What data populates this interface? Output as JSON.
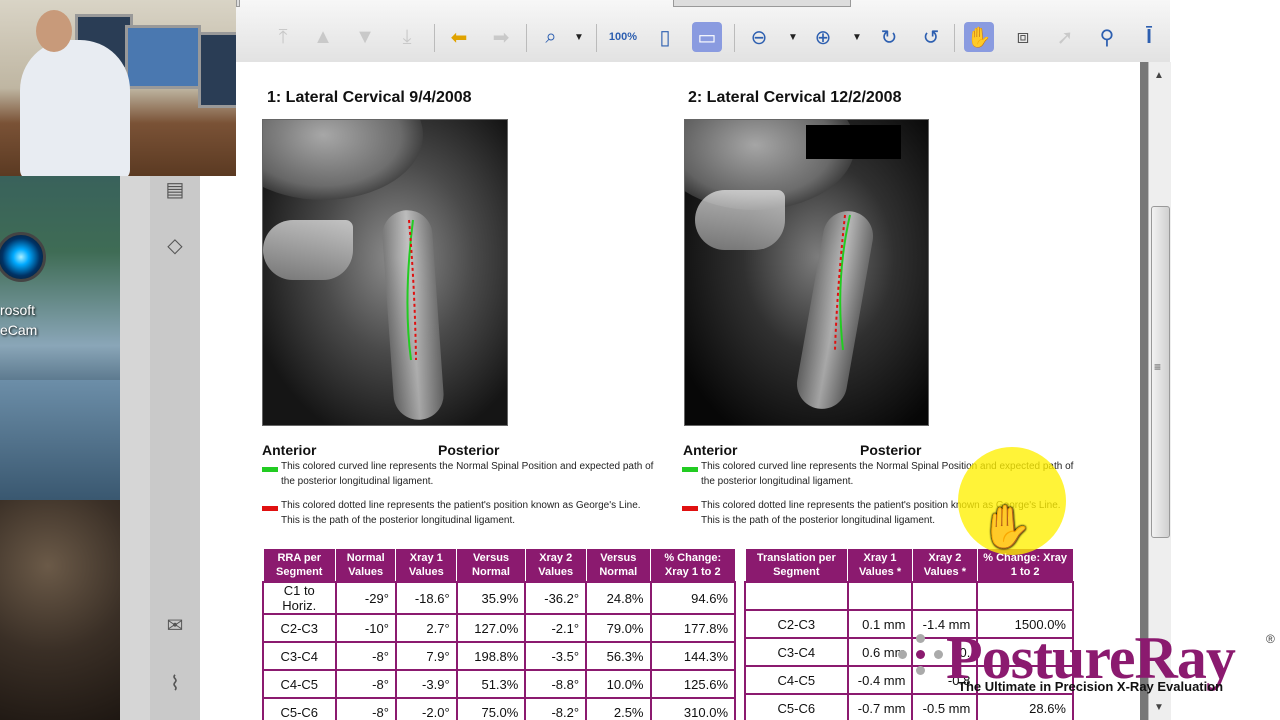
{
  "desktop": {
    "icon_name": "webcam-icon",
    "label_line1": "rosoft",
    "label_line2": "eCam"
  },
  "sidebar": {
    "icons": [
      "page-icon",
      "layers-icon",
      "comment-icon",
      "paperclip-icon"
    ]
  },
  "toolbar": {
    "buttons": [
      {
        "name": "first-page-icon",
        "glyph": "⤒",
        "state": "disabled"
      },
      {
        "name": "prev-page-icon",
        "glyph": "▲",
        "state": "disabled"
      },
      {
        "name": "next-page-icon",
        "glyph": "▼",
        "state": "disabled"
      },
      {
        "name": "last-page-icon",
        "glyph": "⤓",
        "state": "disabled"
      },
      {
        "name": "back-arrow-icon",
        "glyph": "⬅",
        "state": "yellow"
      },
      {
        "name": "forward-arrow-icon",
        "glyph": "➡",
        "state": "disabled"
      },
      {
        "name": "zoom-icon",
        "glyph": "🔍︎",
        "state": "normal"
      },
      {
        "name": "actual-size-icon",
        "glyph": "100%",
        "state": "normal"
      },
      {
        "name": "fit-page-icon",
        "glyph": "▯",
        "state": "normal"
      },
      {
        "name": "fit-width-icon",
        "glyph": "▭",
        "state": "normal"
      },
      {
        "name": "zoom-out-icon",
        "glyph": "⊖",
        "state": "normal"
      },
      {
        "name": "zoom-in-icon",
        "glyph": "⊕",
        "state": "normal"
      },
      {
        "name": "rotate-cw-icon",
        "glyph": "↻",
        "state": "normal"
      },
      {
        "name": "rotate-ccw-icon",
        "glyph": "↺",
        "state": "normal"
      },
      {
        "name": "hand-tool-icon",
        "glyph": "✋",
        "state": "active"
      },
      {
        "name": "snapshot-icon",
        "glyph": "⧈",
        "state": "normal"
      },
      {
        "name": "select-arrow-icon",
        "glyph": "➚",
        "state": "disabled"
      },
      {
        "name": "binoculars-icon",
        "glyph": "⚲",
        "state": "normal"
      },
      {
        "name": "text-select-icon",
        "glyph": "𝐈T",
        "state": "normal"
      }
    ]
  },
  "document": {
    "xray1_title": "1: Lateral Cervical  9/4/2008",
    "xray2_title": "2: Lateral Cervical  12/2/2008",
    "anterior": "Anterior",
    "posterior": "Posterior",
    "legend_green": "This colored curved line represents the Normal Spinal Position and expected path of the posterior longitudinal ligament.",
    "legend_red": "This colored dotted line represents the patient's position known as George's Line. This is the path of the posterior longitudinal ligament.",
    "colors": {
      "green": "#22cc22",
      "red": "#e01010",
      "table_header": "#8b1a6f"
    },
    "rra_table": {
      "headers": [
        "RRA per Segment",
        "Normal Values",
        "Xray 1 Values",
        "Versus Normal",
        "Xray 2 Values",
        "Versus Normal",
        "% Change: Xray 1 to 2"
      ],
      "rows": [
        [
          "C1 to Horiz.",
          "-29°",
          "-18.6°",
          "35.9%",
          "-36.2°",
          "24.8%",
          "94.6%"
        ],
        [
          "C2-C3",
          "-10°",
          "2.7°",
          "127.0%",
          "-2.1°",
          "79.0%",
          "177.8%"
        ],
        [
          "C3-C4",
          "-8°",
          "7.9°",
          "198.8%",
          "-3.5°",
          "56.3%",
          "144.3%"
        ],
        [
          "C4-C5",
          "-8°",
          "-3.9°",
          "51.3%",
          "-8.8°",
          "10.0%",
          "125.6%"
        ],
        [
          "C5-C6",
          "-8°",
          "-2.0°",
          "75.0%",
          "-8.2°",
          "2.5%",
          "310.0%"
        ]
      ]
    },
    "translation_table": {
      "headers": [
        "Translation per Segment",
        "Xray 1 Values *",
        "Xray 2 Values *",
        "% Change: Xray 1 to 2"
      ],
      "rows": [
        [
          "",
          "",
          "",
          ""
        ],
        [
          "C2-C3",
          "0.1 mm",
          "-1.4 mm",
          "1500.0%"
        ],
        [
          "C3-C4",
          "0.6 mm",
          "-0.",
          ""
        ],
        [
          "C4-C5",
          "-0.4 mm",
          "-0.8",
          ""
        ],
        [
          "C5-C6",
          "-0.7 mm",
          "-0.5 mm",
          "28.6%"
        ]
      ]
    }
  },
  "logo": {
    "name": "PostureRay",
    "reg": "®",
    "tagline": "The Ultimate in Precision X-Ray Evaluation"
  }
}
